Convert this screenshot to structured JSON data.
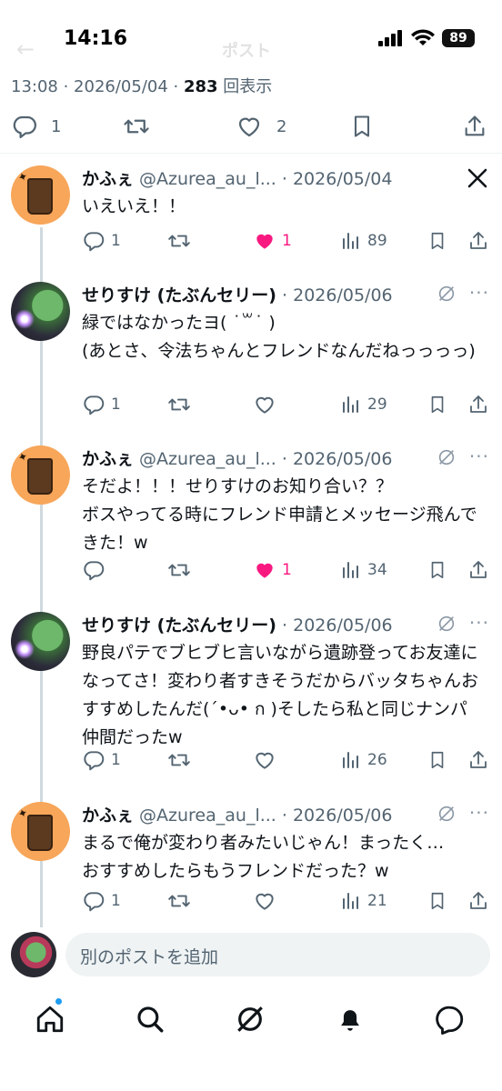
{
  "status_bar": {
    "time": "14:16",
    "battery": "89"
  },
  "header_ghost": {
    "title": "ポスト"
  },
  "post_meta": {
    "time": "13:08",
    "separator": " · ",
    "date": "2026/05/04",
    "views_count": "283",
    "views_label": "回表示"
  },
  "post_actions": {
    "replies": "1",
    "likes": "2"
  },
  "replies": [
    {
      "name": "かふぇ",
      "handle": "@Azurea_au_l...",
      "date": "2026/05/04",
      "text": "いえいえ！！",
      "reply_count": "1",
      "like_count": "1",
      "views": "89"
    },
    {
      "name": "せりすけ (たぶんセリー)",
      "handle": "",
      "date": "2026/05/06",
      "text": "緑ではなかったヨ( ˙꒳˙ )\n(あとさ、令法ちゃんとフレンドなんだねっっっっ)",
      "reply_count": "1",
      "like_count": "",
      "views": "29"
    },
    {
      "name": "かふぇ",
      "handle": "@Azurea_au_l...",
      "date": "2026/05/06",
      "text": "そだよ！！！せりすけのお知り合い？？\nボスやってる時にフレンド申請とメッセージ飛んできた！w",
      "reply_count": "",
      "like_count": "1",
      "views": "34"
    },
    {
      "name": "せりすけ (たぶんセリー)",
      "handle": "",
      "date": "2026/05/06",
      "text": "野良パテでブヒブヒ言いながら遺跡登ってお友達になってさ！変わり者すきそうだからバッタちゃんおすすめしたんだ(´•ᴗ• ก )そしたら私と同じナンパ仲間だったw",
      "reply_count": "1",
      "like_count": "",
      "views": "26"
    },
    {
      "name": "かふぇ",
      "handle": "@Azurea_au_l...",
      "date": "2026/05/06",
      "text": "まるで俺が変わり者みたいじゃん！まったく…\nおすすめしたらもうフレンドだった？w",
      "reply_count": "1",
      "like_count": "",
      "views": "21"
    }
  ],
  "compose": {
    "placeholder": "別のポストを追加"
  },
  "icons": [
    "reply-icon",
    "retweet-icon",
    "heart-icon",
    "bookmark-icon",
    "share-icon",
    "x-logo-icon",
    "grok-icon",
    "more-icon",
    "views-icon",
    "home-icon",
    "search-icon",
    "bell-icon",
    "messages-icon"
  ],
  "colors": {
    "like_pink": "#f91880",
    "muted": "#536471",
    "accent_blue": "#1d9bf0"
  }
}
